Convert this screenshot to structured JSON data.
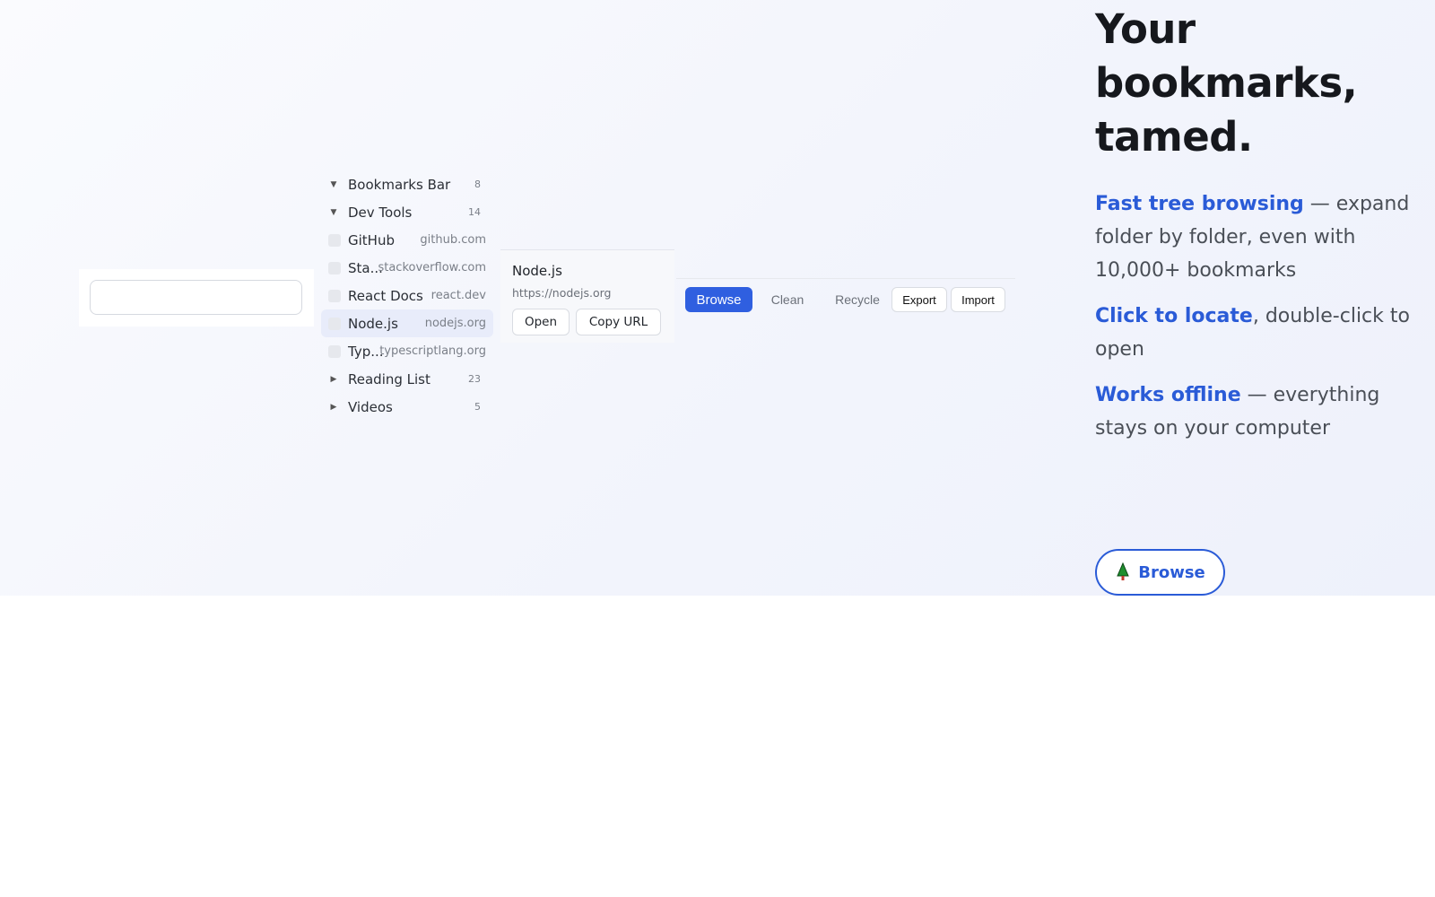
{
  "search": {
    "placeholder": "",
    "value": ""
  },
  "tree": {
    "folders_top": [
      {
        "label": "Bookmarks Bar",
        "count": "8",
        "expanded": true
      },
      {
        "label": "Dev Tools",
        "count": "14",
        "expanded": true
      }
    ],
    "bookmarks": [
      {
        "label": "GitHub",
        "domain": "github.com"
      },
      {
        "label": "Sta...",
        "domain": "stackoverflow.com"
      },
      {
        "label": "React Docs",
        "domain": "react.dev"
      },
      {
        "label": "Node.js",
        "domain": "nodejs.org",
        "selected": true
      },
      {
        "label": "Typ...",
        "domain": "typescriptlang.org"
      }
    ],
    "folders_bottom": [
      {
        "label": "Reading List",
        "count": "23",
        "expanded": false
      },
      {
        "label": "Videos",
        "count": "5",
        "expanded": false
      }
    ]
  },
  "detail": {
    "title": "Node.js",
    "url": "https://nodejs.org",
    "open_label": "Open",
    "copy_label": "Copy URL"
  },
  "toolbar": {
    "browse": "Browse",
    "clean": "Clean",
    "recycle": "Recycle",
    "export": "Export",
    "import": "Import"
  },
  "marketing": {
    "headline_1": "Your",
    "headline_2": "bookmarks,",
    "headline_3": "tamed.",
    "f1_accent": "Fast tree browsing",
    "f1_rest": " — expand folder by folder, even with 10,000+ bookmarks",
    "f2_accent": "Click to locate",
    "f2_rest": ", double-click to open",
    "f3_accent": "Works offline",
    "f3_rest": " — everything stays on your computer",
    "cta_label": "Browse"
  },
  "colors": {
    "accent": "#2a5bd7",
    "primary_button": "#2f5fe0",
    "selected_row": "#e8ecfa"
  },
  "icons": {
    "expanded": "caret-down-icon",
    "collapsed": "caret-right-icon",
    "cta": "tree-icon"
  }
}
